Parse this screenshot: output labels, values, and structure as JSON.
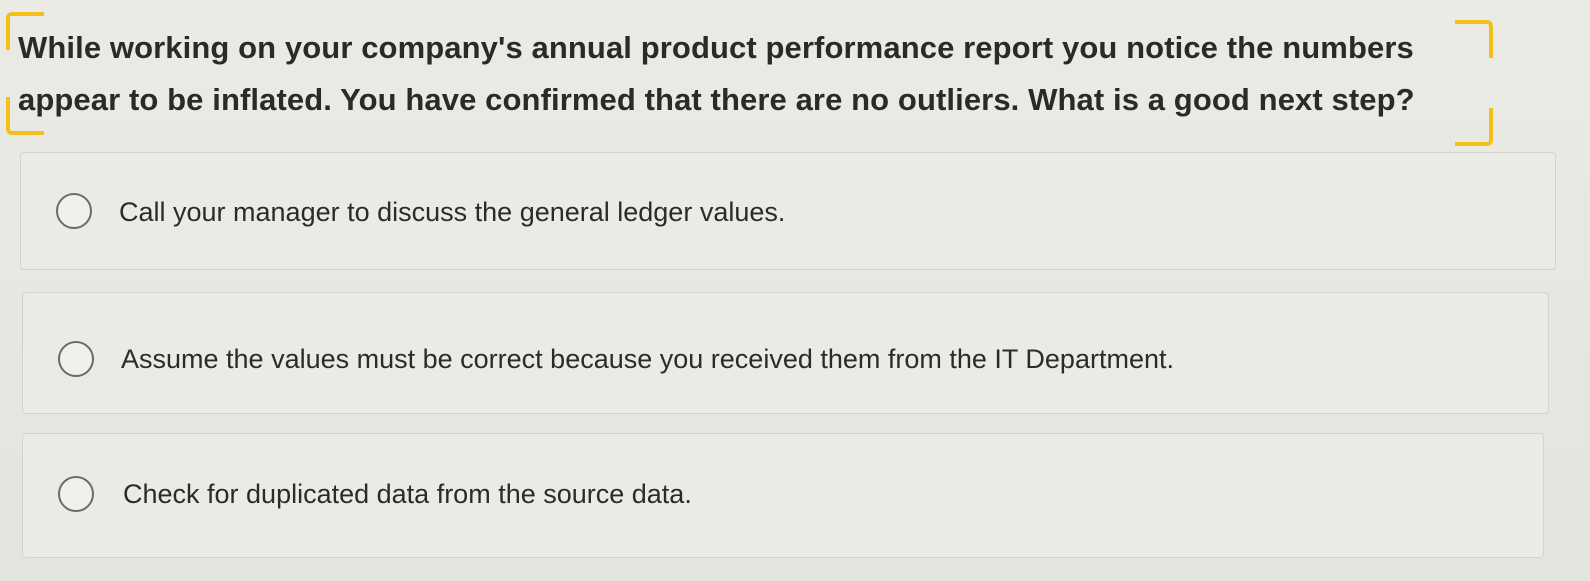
{
  "question": {
    "line1": "While working on your company's annual product performance report you notice the numbers",
    "line2": "appear to be inflated. You have confirmed that there are no outliers. What is a good next step?"
  },
  "options": [
    {
      "label": "Call your manager to discuss the general ledger values.",
      "selected": false
    },
    {
      "label": "Assume the values must be correct because you received them from the IT Department.",
      "selected": false
    },
    {
      "label": "Check for duplicated data from the source data.",
      "selected": false
    }
  ],
  "colors": {
    "highlight_bracket": "#f4bf1a",
    "background": "#e9e9e3",
    "option_border": "#d3d3cd"
  }
}
